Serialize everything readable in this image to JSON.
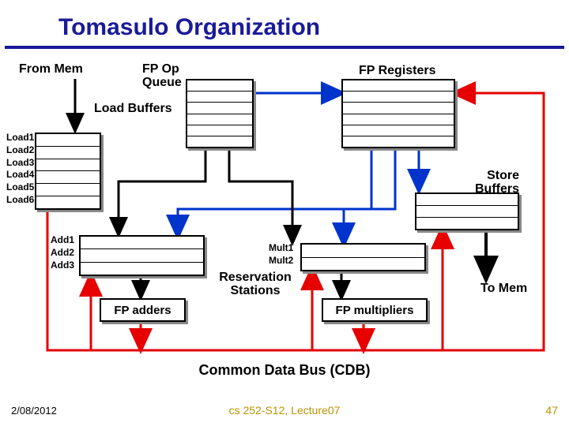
{
  "title": "Tomasulo Organization",
  "labels": {
    "from_mem": "From Mem",
    "fp_op_line1": "FP Op",
    "fp_op_line2": "Queue",
    "load_buffers": "Load Buffers",
    "fp_registers": "FP Registers",
    "store_buffers_line1": "Store",
    "store_buffers_line2": "Buffers",
    "reservation_line1": "Reservation",
    "reservation_line2": "Stations",
    "fp_adders": "FP adders",
    "fp_multipliers": "FP multipliers",
    "to_mem": "To Mem",
    "cdb": "Common Data Bus (CDB)"
  },
  "load_buffers": [
    "Load1",
    "Load2",
    "Load3",
    "Load4",
    "Load5",
    "Load6"
  ],
  "add_rs": [
    "Add1",
    "Add2",
    "Add3"
  ],
  "mult_rs": [
    "Mult1",
    "Mult2"
  ],
  "footer": {
    "date": "2/08/2012",
    "center": "cs 252-S12, Lecture07",
    "page": "47"
  }
}
